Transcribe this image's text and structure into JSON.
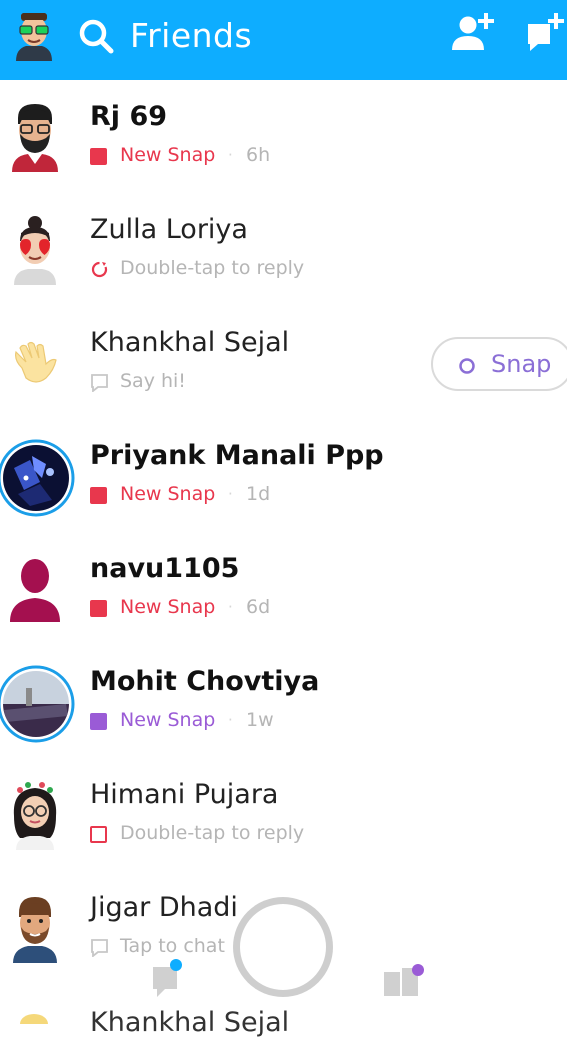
{
  "header": {
    "title": "Friends",
    "icons": [
      "bitmoji-avatar-icon",
      "search-icon",
      "add-friend-icon",
      "new-chat-icon"
    ],
    "color": "#0eadff"
  },
  "friends": [
    {
      "name": "Rj 69",
      "status": "New Snap",
      "time": "6h",
      "status_type": "new-snap-red"
    },
    {
      "name": "Zulla Loriya",
      "status": "Double-tap to reply",
      "time": "",
      "status_type": "replay-red"
    },
    {
      "name": "Khankhal Sejal",
      "status": "Say hi!",
      "time": "",
      "status_type": "chat-gray",
      "action": "Snap"
    },
    {
      "name": "Priyank Manali Ppp",
      "status": "New Snap",
      "time": "1d",
      "status_type": "new-snap-red"
    },
    {
      "name": "navu1105",
      "status": "New Snap",
      "time": "6d",
      "status_type": "new-snap-red"
    },
    {
      "name": "Mohit Chovtiya",
      "status": "New Snap",
      "time": "1w",
      "status_type": "new-snap-purple"
    },
    {
      "name": "Himani Pujara",
      "status": "Double-tap to reply",
      "time": "",
      "status_type": "opened-red"
    },
    {
      "name": "Jigar Dhadi",
      "status": "Tap to chat",
      "time": "",
      "status_type": "chat-gray"
    }
  ],
  "partial_row": {
    "name": "Khankhal Sejal"
  },
  "colors": {
    "new_snap_red": "#e8374d",
    "new_snap_purple": "#9a5bd6",
    "secondary_gray": "#b5b5b5",
    "notification_blue": "#0eadff",
    "notification_purple": "#9a5bd6"
  },
  "bottom_nav": {
    "icons": [
      "chat-icon",
      "capture-button",
      "stories-icon"
    ]
  }
}
